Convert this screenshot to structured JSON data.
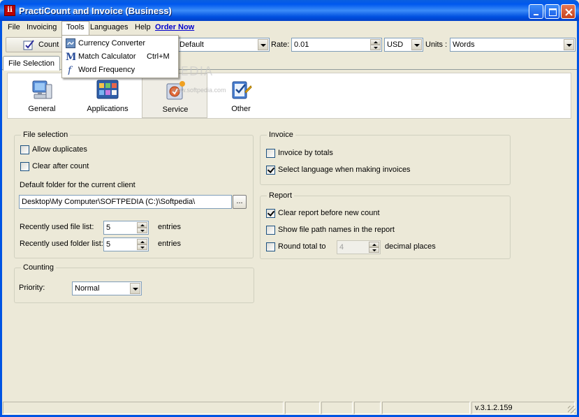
{
  "window": {
    "title": "PractiCount and Invoice (Business)",
    "app_icon_text": "ii"
  },
  "menubar": {
    "items": [
      "File",
      "Invoicing",
      "Tools",
      "Languages",
      "Help"
    ],
    "order_now": "Order Now"
  },
  "tools_menu": {
    "items": [
      {
        "label": "Currency Converter",
        "shortcut": "",
        "icon": "currency-converter-icon"
      },
      {
        "label": "Match Calculator",
        "shortcut": "Ctrl+M",
        "icon": "m-letter-icon"
      },
      {
        "label": "Word Frequency",
        "shortcut": "",
        "icon": "function-f-icon"
      }
    ]
  },
  "toolbar": {
    "count_label": "Count",
    "profile_value": "Default",
    "rate_label": "Rate:",
    "rate_value": "0.01",
    "currency_value": "USD",
    "units_label": "Units :",
    "units_value": "Words"
  },
  "tabs": {
    "file_selection": "File Selection"
  },
  "categories": [
    {
      "label": "General",
      "icon": "computer-icon",
      "selected": false
    },
    {
      "label": "Applications",
      "icon": "applications-icon",
      "selected": false
    },
    {
      "label": "Service",
      "icon": "service-icon",
      "selected": true
    },
    {
      "label": "Other",
      "icon": "other-checklist-icon",
      "selected": false
    }
  ],
  "watermark": {
    "main": "SOFTPEDIA",
    "sub": "www.softpedia.com"
  },
  "file_selection": {
    "title": "File selection",
    "allow_duplicates": {
      "label": "Allow duplicates",
      "checked": false
    },
    "clear_after_count": {
      "label": "Clear after count",
      "checked": false
    },
    "default_folder_label": "Default folder for the current client",
    "default_folder_value": "Desktop\\My Computer\\SOFTPEDIA (C:)\\Softpedia\\",
    "browse_label": "...",
    "recent_files_label": "Recently used file list:",
    "recent_files_value": "5",
    "recent_folders_label": "Recently used folder list:",
    "recent_folders_value": "5",
    "entries_label": "entries"
  },
  "counting": {
    "title": "Counting",
    "priority_label": "Priority:",
    "priority_value": "Normal"
  },
  "invoice": {
    "title": "Invoice",
    "invoice_by_totals": {
      "label": "Invoice by totals",
      "checked": false
    },
    "select_language": {
      "label": "Select language when making invoices",
      "checked": true
    }
  },
  "report": {
    "title": "Report",
    "clear_report": {
      "label": "Clear report before new count",
      "checked": true
    },
    "show_path": {
      "label": "Show file path names in the report",
      "checked": false
    },
    "round_total": {
      "label": "Round total to",
      "checked": false
    },
    "round_value": "4",
    "decimal_label": "decimal places"
  },
  "statusbar": {
    "version": "v.3.1.2.159"
  }
}
